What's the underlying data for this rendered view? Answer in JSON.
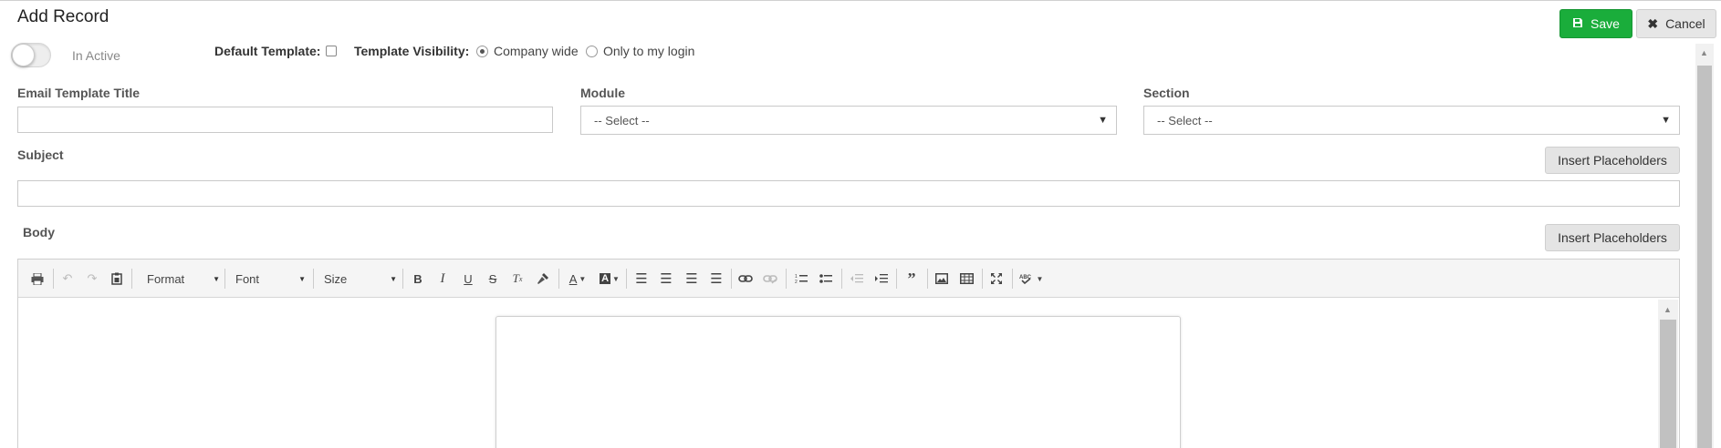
{
  "header": {
    "title": "Add Record",
    "save_label": "Save",
    "cancel_label": "Cancel"
  },
  "status": {
    "toggle_on": false,
    "toggle_label": "In Active"
  },
  "options": {
    "default_template_label": "Default Template:",
    "default_template_checked": false,
    "visibility_label": "Template Visibility:",
    "visibility_options": [
      "Company wide",
      "Only to my login"
    ],
    "visibility_selected": "Company wide"
  },
  "form": {
    "title_label": "Email Template Title",
    "title_value": "",
    "module_label": "Module",
    "module_value": "-- Select --",
    "section_label": "Section",
    "section_value": "-- Select --",
    "subject_label": "Subject",
    "subject_value": "",
    "body_label": "Body",
    "insert_placeholders_label": "Insert Placeholders"
  },
  "editor": {
    "format_label": "Format",
    "font_label": "Font",
    "size_label": "Size",
    "toolbar_buttons": [
      "print",
      "undo",
      "redo",
      "paste-text",
      "bold",
      "italic",
      "underline",
      "strikethrough",
      "remove-format",
      "copy-formatting",
      "text-color",
      "background-color",
      "align-left",
      "align-center",
      "align-right",
      "justify",
      "link",
      "unlink",
      "numbered-list",
      "bulleted-list",
      "decrease-indent",
      "increase-indent",
      "blockquote",
      "image",
      "table",
      "maximize",
      "spell-check"
    ]
  },
  "colors": {
    "save_button": "#1aad3b",
    "secondary_button": "#e4e4e4"
  }
}
